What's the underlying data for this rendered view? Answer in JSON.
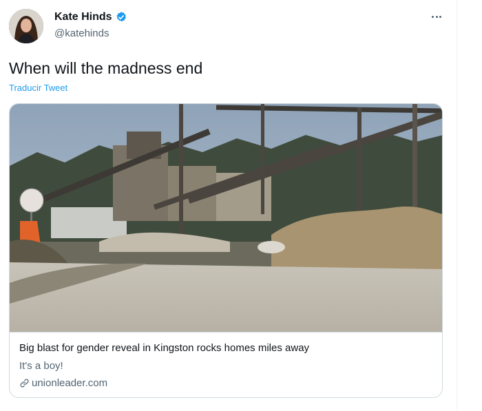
{
  "tweet": {
    "author_name": "Kate Hinds",
    "author_handle": "@katehinds",
    "text": "When will the madness end",
    "translate_label": "Traducir Tweet"
  },
  "card": {
    "title": "Big blast for gender reveal in Kingston rocks homes miles away",
    "description": "It's a boy!",
    "domain": "unionleader.com"
  },
  "colors": {
    "accent": "#1d9bf0",
    "secondary_text": "#536471",
    "border": "#cfd9de"
  },
  "icons": {
    "verified": "verified-badge-icon",
    "more": "more-options-icon",
    "link": "link-icon"
  }
}
